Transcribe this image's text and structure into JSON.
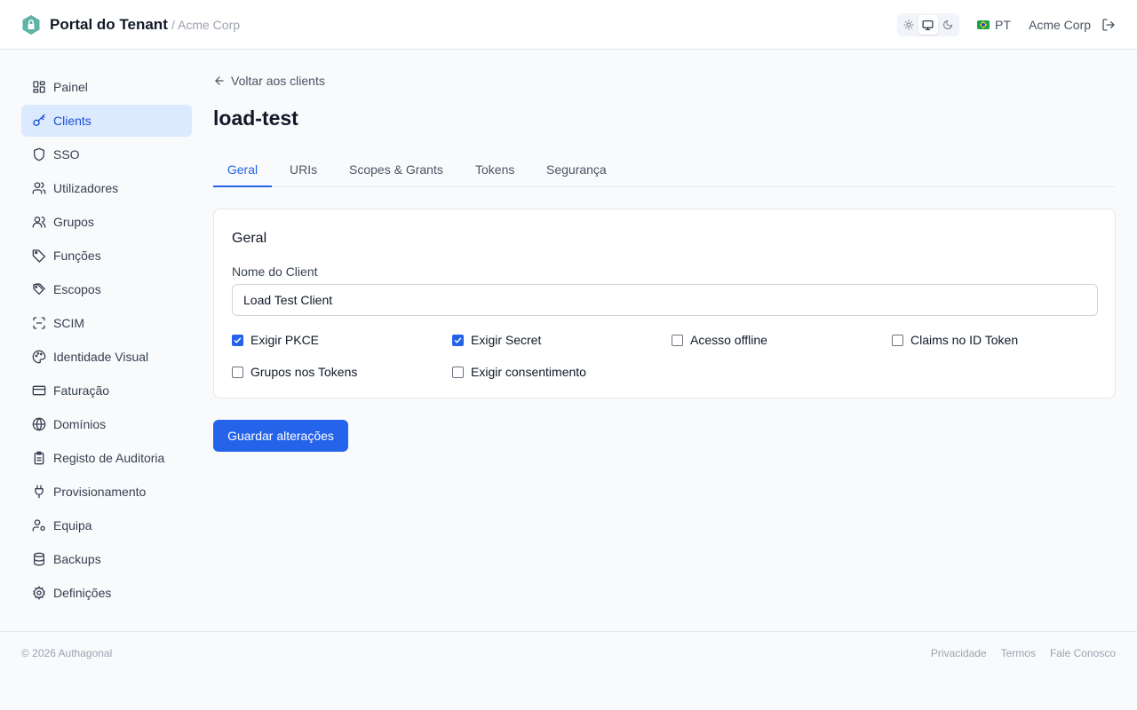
{
  "header": {
    "app_title": "Portal do Tenant",
    "tenant_crumb": "/ Acme Corp",
    "language": "PT",
    "tenant_name": "Acme Corp",
    "theme_selected": "system"
  },
  "sidebar": {
    "items": [
      {
        "label": "Painel",
        "icon": "dashboard-icon"
      },
      {
        "label": "Clients",
        "icon": "key-icon",
        "active": true
      },
      {
        "label": "SSO",
        "icon": "shield-icon"
      },
      {
        "label": "Utilizadores",
        "icon": "users-icon"
      },
      {
        "label": "Grupos",
        "icon": "group-icon"
      },
      {
        "label": "Funções",
        "icon": "tag-icon"
      },
      {
        "label": "Escopos",
        "icon": "tags-icon"
      },
      {
        "label": "SCIM",
        "icon": "scan-icon"
      },
      {
        "label": "Identidade Visual",
        "icon": "palette-icon"
      },
      {
        "label": "Faturação",
        "icon": "credit-card-icon"
      },
      {
        "label": "Domínios",
        "icon": "globe-icon"
      },
      {
        "label": "Registo de Auditoria",
        "icon": "clipboard-icon"
      },
      {
        "label": "Provisionamento",
        "icon": "plug-icon"
      },
      {
        "label": "Equipa",
        "icon": "user-cog-icon"
      },
      {
        "label": "Backups",
        "icon": "database-icon"
      },
      {
        "label": "Definições",
        "icon": "gear-icon"
      }
    ]
  },
  "main": {
    "back_link": "Voltar aos clients",
    "title": "load-test",
    "tabs": [
      {
        "label": "Geral",
        "active": true
      },
      {
        "label": "URIs"
      },
      {
        "label": "Scopes & Grants"
      },
      {
        "label": "Tokens"
      },
      {
        "label": "Segurança"
      }
    ],
    "card": {
      "title": "Geral",
      "name_label": "Nome do Client",
      "name_value": "Load Test Client",
      "checkboxes": [
        {
          "label": "Exigir PKCE",
          "checked": true
        },
        {
          "label": "Exigir Secret",
          "checked": true
        },
        {
          "label": "Acesso offline",
          "checked": false
        },
        {
          "label": "Claims no ID Token",
          "checked": false
        },
        {
          "label": "Grupos nos Tokens",
          "checked": false
        },
        {
          "label": "Exigir consentimento",
          "checked": false
        }
      ]
    },
    "save_label": "Guardar alterações"
  },
  "footer": {
    "copyright": "© 2026 Authagonal",
    "links": [
      "Privacidade",
      "Termos",
      "Fale Conosco"
    ]
  },
  "colors": {
    "accent": "#2563eb",
    "active_nav_bg": "#dbeafe",
    "logo": "#5fb3a7"
  }
}
